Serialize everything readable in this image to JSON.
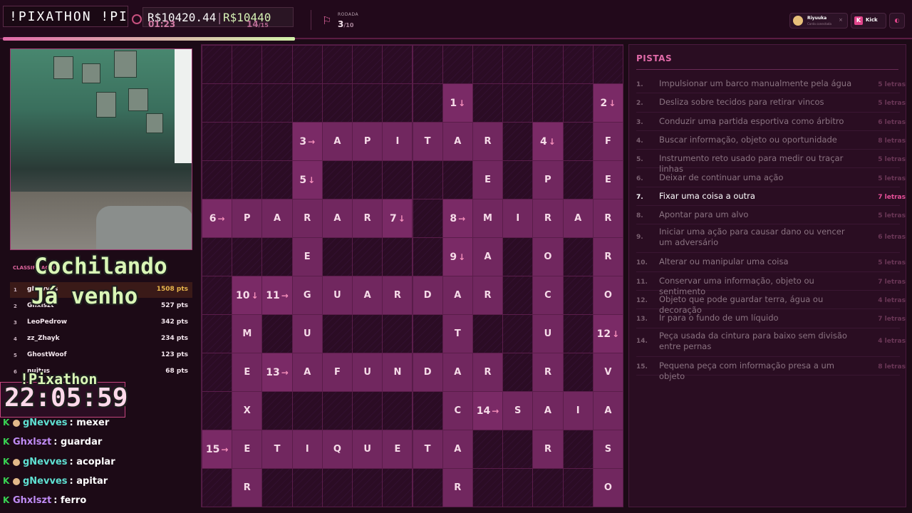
{
  "header": {
    "marquee": "!PIXATHON !PIX",
    "money_a": "R$10420.44",
    "money_b": "R$10440",
    "timer": "01:23",
    "question_current": "14",
    "question_total": "/15",
    "round_label": "RODADA",
    "round_current": "3",
    "round_total": "/10",
    "user_name": "Riyuuka",
    "user_sub": "Conta conectada",
    "kick_label": "Kick"
  },
  "overlay": {
    "line1": "Cochilando",
    "line2": "Já venho",
    "pixathon": "!Pixathon",
    "clock": "22:05:59"
  },
  "leaderboard": {
    "title": "CLASSIFICAÇÃO",
    "rows": [
      {
        "rank": "1",
        "name": "gNevves",
        "pts": "1508 pts"
      },
      {
        "rank": "2",
        "name": "Ghxlszt",
        "pts": "527 pts"
      },
      {
        "rank": "3",
        "name": "LeoPedrow",
        "pts": "342 pts"
      },
      {
        "rank": "4",
        "name": "zz_Zhayk",
        "pts": "234 pts"
      },
      {
        "rank": "5",
        "name": "GhostWoof",
        "pts": "123 pts"
      },
      {
        "rank": "6",
        "name": "nuitus",
        "pts": "68 pts"
      }
    ]
  },
  "chat": [
    {
      "user": "gNevves",
      "msg": "mexer",
      "color": "#5fe0d2",
      "badge": true
    },
    {
      "user": "Ghxlszt",
      "msg": "guardar",
      "color": "#c08cf5",
      "badge": false
    },
    {
      "user": "gNevves",
      "msg": "acoplar",
      "color": "#5fe0d2",
      "badge": true
    },
    {
      "user": "gNevves",
      "msg": "apitar",
      "color": "#5fe0d2",
      "badge": true
    },
    {
      "user": "Ghxlszt",
      "msg": "ferro",
      "color": "#c08cf5",
      "badge": false
    }
  ],
  "crossword": {
    "cells": [
      [
        1,
        "1↓",
        "r",
        8
      ],
      [
        1,
        "2↓",
        "r",
        13
      ],
      [
        2,
        "3→",
        "r",
        3
      ],
      [
        2,
        "A",
        "r",
        4
      ],
      [
        2,
        "P",
        "r",
        5
      ],
      [
        2,
        "I",
        "r",
        6
      ],
      [
        2,
        "T",
        "r",
        7
      ],
      [
        2,
        "A",
        "r",
        8
      ],
      [
        2,
        "R",
        "r",
        9
      ],
      [
        2,
        "4↓",
        "r",
        11
      ],
      [
        2,
        "F",
        "r",
        13
      ],
      [
        3,
        "5↓",
        "r",
        3
      ],
      [
        3,
        "E",
        "r",
        9
      ],
      [
        3,
        "P",
        "r",
        11
      ],
      [
        3,
        "E",
        "r",
        13
      ],
      [
        4,
        "6→",
        "r",
        0
      ],
      [
        4,
        "P",
        "r",
        1
      ],
      [
        4,
        "A",
        "r",
        2
      ],
      [
        4,
        "R",
        "r",
        3
      ],
      [
        4,
        "A",
        "r",
        4
      ],
      [
        4,
        "R",
        "r",
        5
      ],
      [
        4,
        "7↓",
        "r",
        6
      ],
      [
        4,
        "8→",
        "r",
        8
      ],
      [
        4,
        "M",
        "r",
        9
      ],
      [
        4,
        "I",
        "r",
        10
      ],
      [
        4,
        "R",
        "r",
        11
      ],
      [
        4,
        "A",
        "r",
        12
      ],
      [
        4,
        "R",
        "r",
        13
      ],
      [
        5,
        "E",
        "r",
        3
      ],
      [
        5,
        "9↓",
        "r",
        8
      ],
      [
        5,
        "A",
        "r",
        9
      ],
      [
        5,
        "O",
        "r",
        11
      ],
      [
        5,
        "R",
        "r",
        13
      ],
      [
        6,
        "10↓",
        "r",
        1
      ],
      [
        6,
        "11→",
        "r",
        2
      ],
      [
        6,
        "G",
        "r",
        3
      ],
      [
        6,
        "U",
        "r",
        4
      ],
      [
        6,
        "A",
        "r",
        5
      ],
      [
        6,
        "R",
        "r",
        6
      ],
      [
        6,
        "D",
        "r",
        7
      ],
      [
        6,
        "A",
        "r",
        8
      ],
      [
        6,
        "R",
        "r",
        9
      ],
      [
        6,
        "C",
        "r",
        11
      ],
      [
        6,
        "O",
        "r",
        13
      ],
      [
        7,
        "M",
        "r",
        1
      ],
      [
        7,
        "U",
        "r",
        3
      ],
      [
        7,
        "T",
        "r",
        8
      ],
      [
        7,
        "U",
        "r",
        11
      ],
      [
        7,
        "12↓",
        "r",
        13
      ],
      [
        8,
        "E",
        "r",
        1
      ],
      [
        8,
        "13→",
        "r",
        2
      ],
      [
        8,
        "A",
        "r",
        3
      ],
      [
        8,
        "F",
        "r",
        4
      ],
      [
        8,
        "U",
        "r",
        5
      ],
      [
        8,
        "N",
        "r",
        6
      ],
      [
        8,
        "D",
        "r",
        7
      ],
      [
        8,
        "A",
        "r",
        8
      ],
      [
        8,
        "R",
        "r",
        9
      ],
      [
        8,
        "R",
        "r",
        11
      ],
      [
        8,
        "V",
        "r",
        13
      ],
      [
        9,
        "X",
        "r",
        1
      ],
      [
        9,
        "C",
        "r",
        8
      ],
      [
        9,
        "14→",
        "r",
        9
      ],
      [
        9,
        "S",
        "r",
        10
      ],
      [
        9,
        "A",
        "r",
        11
      ],
      [
        9,
        "I",
        "r",
        12
      ],
      [
        9,
        "A",
        "r",
        13
      ],
      [
        10,
        "15→",
        "r",
        0
      ],
      [
        10,
        "E",
        "r",
        1
      ],
      [
        10,
        "T",
        "r",
        2
      ],
      [
        10,
        "I",
        "r",
        3
      ],
      [
        10,
        "Q",
        "r",
        4
      ],
      [
        10,
        "U",
        "r",
        5
      ],
      [
        10,
        "E",
        "r",
        6
      ],
      [
        10,
        "T",
        "r",
        7
      ],
      [
        10,
        "A",
        "r",
        8
      ],
      [
        10,
        "R",
        "r",
        11
      ],
      [
        10,
        "S",
        "r",
        13
      ],
      [
        11,
        "R",
        "r",
        1
      ],
      [
        11,
        "R",
        "r",
        8
      ],
      [
        11,
        "O",
        "r",
        13
      ]
    ]
  },
  "clues": {
    "title": "PISTAS",
    "items": [
      {
        "n": "1.",
        "text": "Impulsionar um barco manualmente pela água",
        "len": "5 letras"
      },
      {
        "n": "2.",
        "text": "Desliza sobre tecidos para retirar vincos",
        "len": "5 letras"
      },
      {
        "n": "3.",
        "text": "Conduzir uma partida esportiva como árbitro",
        "len": "6 letras"
      },
      {
        "n": "4.",
        "text": "Buscar informação, objeto ou oportunidade",
        "len": "8 letras"
      },
      {
        "n": "5.",
        "text": "Instrumento reto usado para medir ou traçar linhas",
        "len": "5 letras"
      },
      {
        "n": "6.",
        "text": "Deixar de continuar uma ação",
        "len": "5 letras"
      },
      {
        "n": "7.",
        "text": "Fixar uma coisa a outra",
        "len": "7 letras",
        "active": true
      },
      {
        "n": "8.",
        "text": "Apontar para um alvo",
        "len": "5 letras"
      },
      {
        "n": "9.",
        "text": "Iniciar uma ação para causar dano ou vencer um adversário",
        "len": "6 letras"
      },
      {
        "n": "10.",
        "text": "Alterar ou manipular uma coisa",
        "len": "5 letras"
      },
      {
        "n": "11.",
        "text": "Conservar uma informação, objeto ou sentimento",
        "len": "7 letras"
      },
      {
        "n": "12.",
        "text": "Objeto que pode guardar terra, água ou decoração",
        "len": "4 letras"
      },
      {
        "n": "13.",
        "text": "Ir para o fundo de um líquido",
        "len": "7 letras"
      },
      {
        "n": "14.",
        "text": "Peça usada da cintura para baixo sem divisão entre pernas",
        "len": "4 letras"
      },
      {
        "n": "15.",
        "text": "Pequena peça com informação presa a um objeto",
        "len": "8 letras"
      }
    ]
  },
  "colors": {
    "accent": "#e06aa8",
    "cell": "#71275f",
    "lime": "#d6f2b5"
  }
}
